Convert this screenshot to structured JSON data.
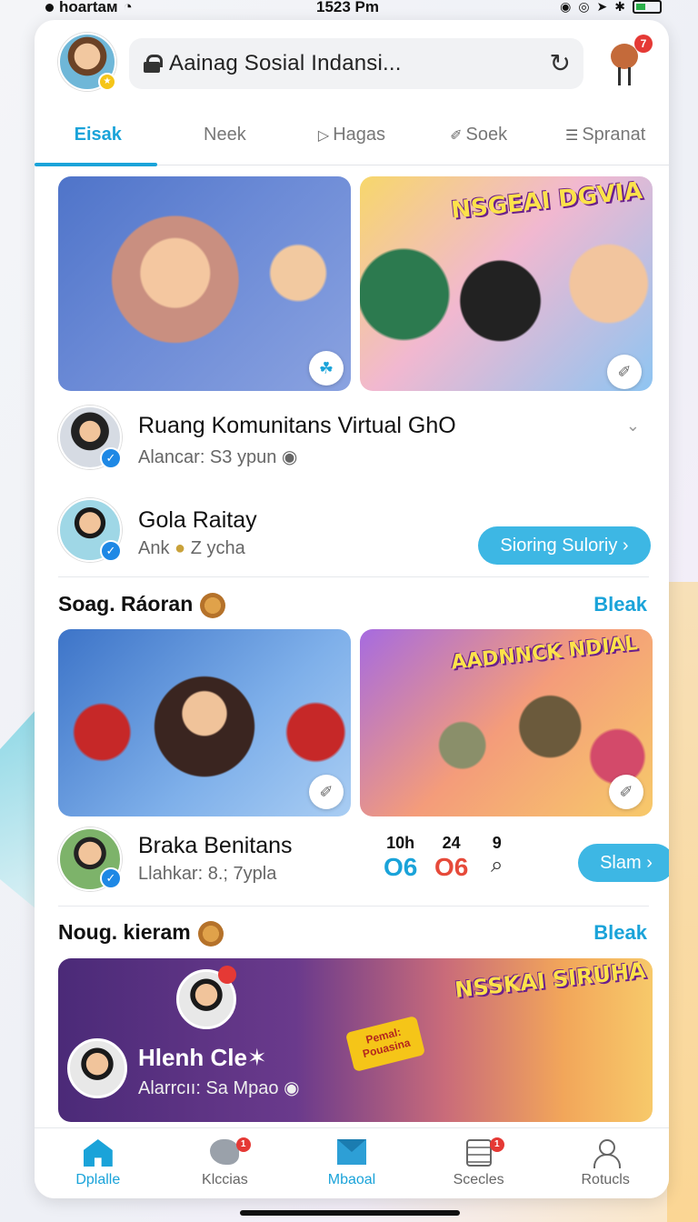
{
  "status_bar": {
    "carrier": "hoartaм",
    "time": "1523 Pm"
  },
  "header": {
    "search_text": "Aainag Sosial Indansi...",
    "notification_count": "7"
  },
  "tabs": [
    {
      "label": "Eisak",
      "active": true
    },
    {
      "label": "Neek",
      "active": false
    },
    {
      "label": "Hagas",
      "active": false
    },
    {
      "label": "Soek",
      "active": false
    },
    {
      "label": "Spranat",
      "active": false
    }
  ],
  "images": {
    "tile2_title": "NSGEAI DGVIA",
    "tile4_title": "AADNNCK NDIAL",
    "banner_title": "NSSKAI SIRUHA",
    "banner_sticker": "Pemal: Pouasina"
  },
  "rows": [
    {
      "title": "Ruang Komunitans Virtual GhO",
      "subtitle": "Alancar: S3 ypun"
    },
    {
      "title": "Gola Raitay",
      "subtitle": "Ank",
      "subtitle_suffix": "Z ycha",
      "button": "Sioring Suloriy"
    }
  ],
  "sections": [
    {
      "title": "Soag. Ráoran",
      "link": "Bleak"
    },
    {
      "title": "Noug. kieram",
      "link": "Bleak"
    }
  ],
  "post_row": {
    "title": "Braka Benitans",
    "subtitle": "Llahkar: 8.; 7ypla",
    "stats": [
      {
        "label": "10h",
        "value": "O6"
      },
      {
        "label": "24",
        "value": "O6"
      },
      {
        "label": "9",
        "value": ""
      }
    ],
    "button": "Slam"
  },
  "banner": {
    "title": "Hlenh Cle✶",
    "subtitle": "Alarrcıı: Sa Mpao"
  },
  "bottom_nav": [
    {
      "label": "Dplalle",
      "icon": "home-icon",
      "badge": ""
    },
    {
      "label": "Klccias",
      "icon": "bird-icon",
      "badge": "1"
    },
    {
      "label": "Mbaoal",
      "icon": "mail-icon",
      "badge": ""
    },
    {
      "label": "Scecles",
      "icon": "notes-icon",
      "badge": "1"
    },
    {
      "label": "Rotucls",
      "icon": "profile-icon",
      "badge": ""
    }
  ],
  "colors": {
    "accent": "#1aa3d9",
    "danger": "#e53935",
    "button": "#3db7e4"
  }
}
